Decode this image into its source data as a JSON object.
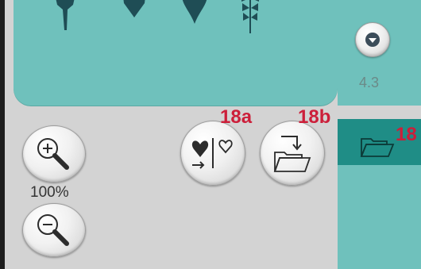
{
  "stitch_panel": {
    "stitches": [
      "leaf-stitch-1",
      "leaf-stitch-2",
      "heart-stitch",
      "fern-stitch"
    ]
  },
  "version": {
    "label": "4.3"
  },
  "zoom": {
    "level": "100%"
  },
  "callouts": {
    "a": "18a",
    "b": "18b",
    "c": "18"
  },
  "colors": {
    "panel": "#6fc1bc",
    "panel_selected": "#1f8d86",
    "callout": "#cc1f3a",
    "background": "#d3d3d3"
  }
}
